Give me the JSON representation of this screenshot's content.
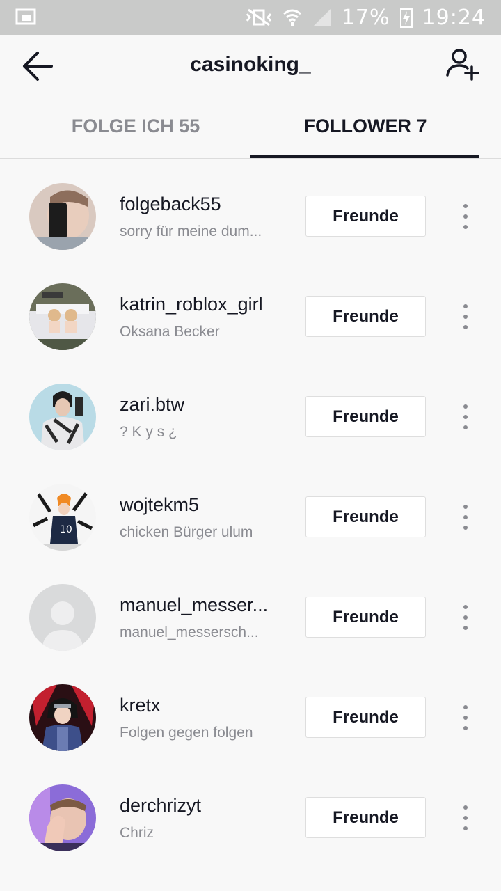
{
  "status_bar": {
    "battery": "17%",
    "time": "19:24",
    "icons": [
      "screen-cast-icon",
      "vibrate-mute-icon",
      "wifi-icon",
      "signal-icon",
      "charging-icon"
    ]
  },
  "header": {
    "title": "casinoking_",
    "back_icon": "arrow-left-icon",
    "add_icon": "add-user-icon"
  },
  "tabs": [
    {
      "label": "FOLGE ICH 55",
      "active": false
    },
    {
      "label": "FOLLOWER 7",
      "active": true
    }
  ],
  "followers": [
    {
      "username": "folgeback55",
      "subtitle": "sorry für meine dum...",
      "button": "Freunde"
    },
    {
      "username": "katrin_roblox_girl",
      "subtitle": "Oksana Becker",
      "button": "Freunde"
    },
    {
      "username": "zari.btw",
      "subtitle": "? K y s ¿",
      "button": "Freunde"
    },
    {
      "username": "wojtekm5",
      "subtitle": "chicken Bürger ulum",
      "button": "Freunde"
    },
    {
      "username": "manuel_messer...",
      "subtitle": "manuel_messersch...",
      "button": "Freunde"
    },
    {
      "username": "kretx",
      "subtitle": "Folgen gegen folgen",
      "button": "Freunde"
    },
    {
      "username": "derchrizyt",
      "subtitle": "Chriz",
      "button": "Freunde"
    }
  ],
  "colors": {
    "text_primary": "#161823",
    "text_secondary": "#8a8b91",
    "status_bar_bg": "#c9cac9",
    "page_bg": "#f8f8f8"
  }
}
